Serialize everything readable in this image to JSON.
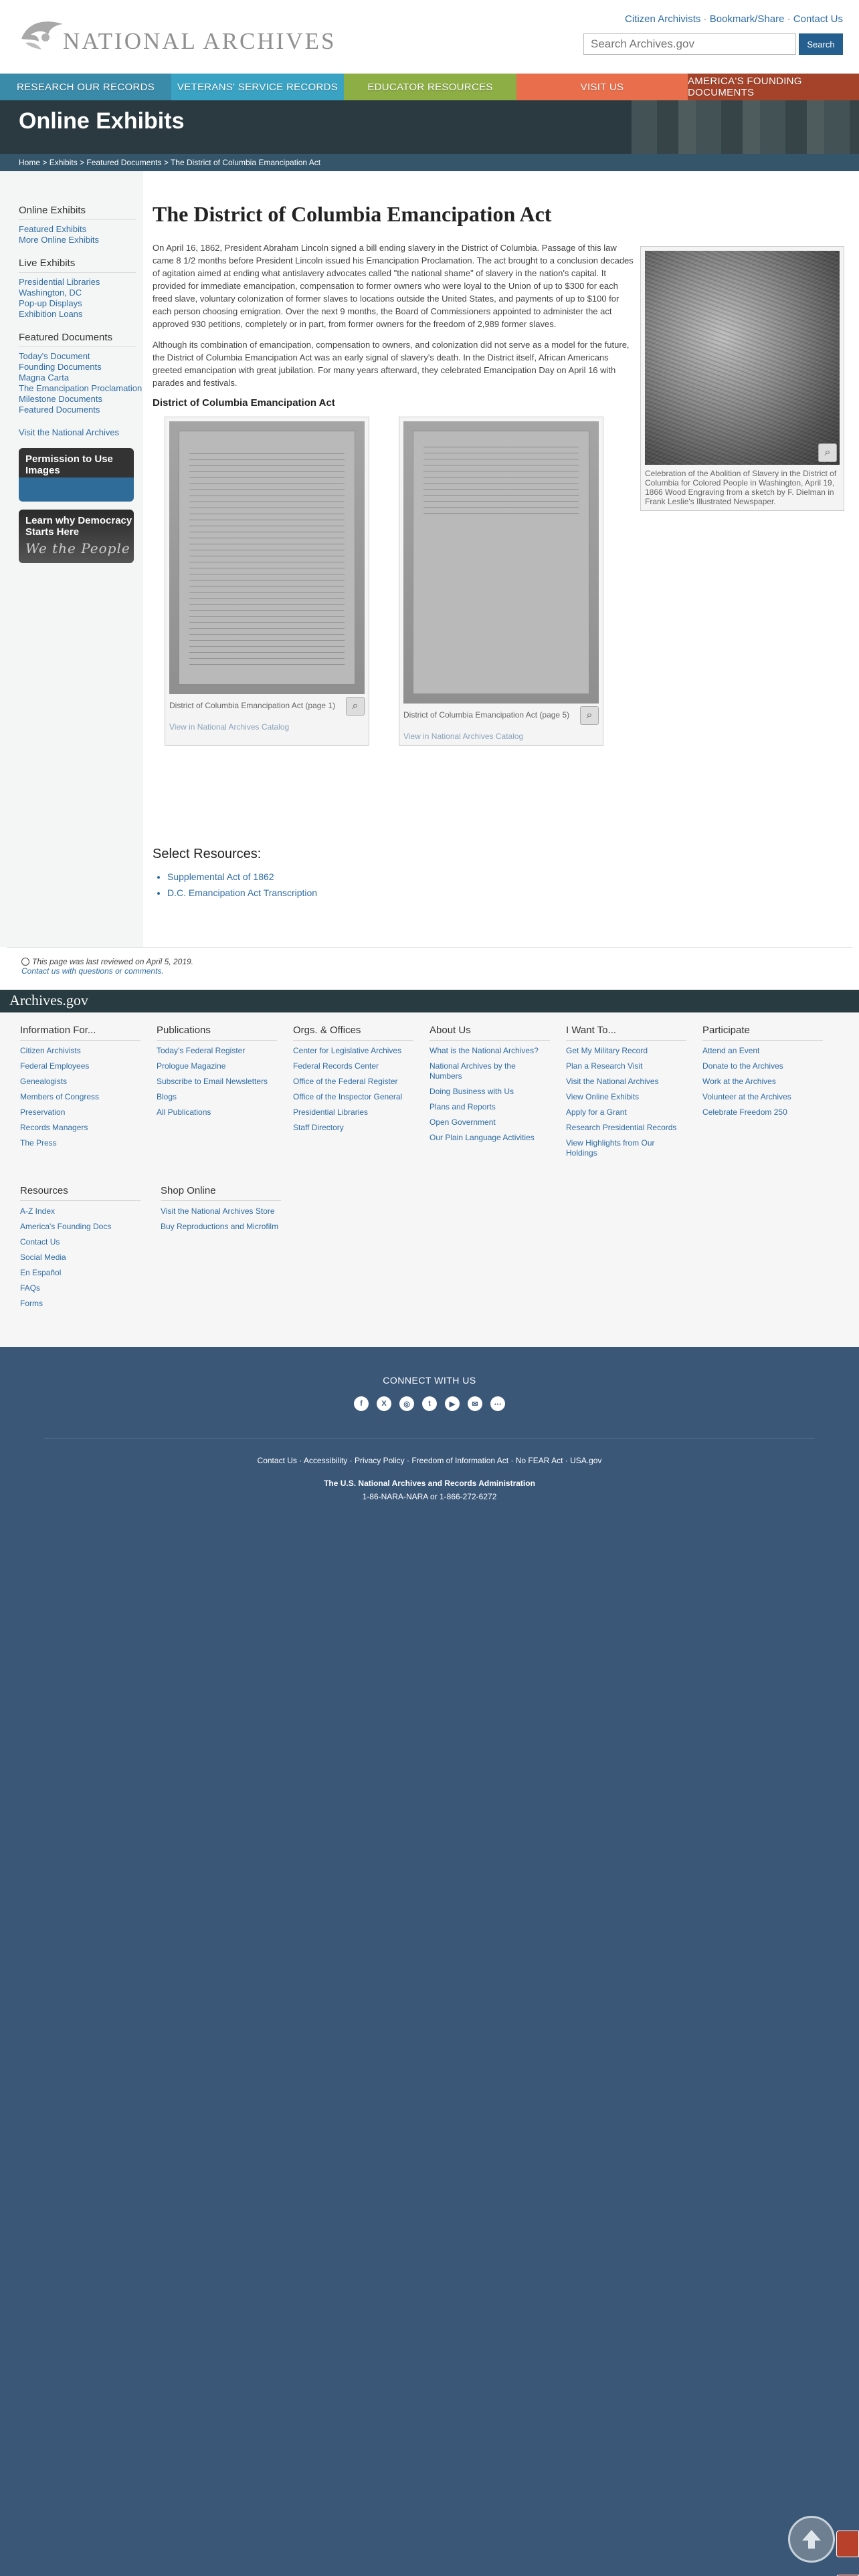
{
  "header": {
    "logo_text": "NATIONAL ARCHIVES",
    "utility_links": [
      "Citizen Archivists",
      "Bookmark/Share",
      "Contact Us"
    ],
    "search_placeholder": "Search Archives.gov",
    "search_button": "Search"
  },
  "nav": [
    {
      "label": "Research Our Records",
      "color": "#3a8aa9"
    },
    {
      "label": "Veterans' Service Records",
      "color": "#3aa3c4"
    },
    {
      "label": "Educator Resources",
      "color": "#8cae44"
    },
    {
      "label": "Visit Us",
      "color": "#e96e4c"
    },
    {
      "label": "America's Founding Documents",
      "color": "#a5432a"
    }
  ],
  "hero": {
    "title": "Online Exhibits"
  },
  "breadcrumb": [
    "Home",
    "Exhibits",
    "Featured Documents",
    "The District of Columbia Emancipation Act"
  ],
  "sidebar": {
    "sections": [
      {
        "heading": "Online Exhibits",
        "items": [
          "Featured Exhibits",
          "More Online Exhibits"
        ]
      },
      {
        "heading": "Live Exhibits",
        "items": [
          "Presidential Libraries",
          "Washington, DC",
          "Pop-up Displays",
          "Exhibition Loans"
        ]
      },
      {
        "heading": "Featured Documents",
        "items": [
          "Today's Document",
          "Founding Documents",
          "Magna Carta",
          "The Emancipation Proclamation",
          "Milestone Documents",
          "Featured Documents"
        ]
      }
    ],
    "visit_link": "Visit the National Archives",
    "promo_permission": "Permission to Use Images",
    "promo_democracy": "Learn why Democracy Starts Here"
  },
  "main": {
    "title": "The District of Columbia Emancipation Act",
    "paragraphs": [
      "On April 16, 1862, President Abraham Lincoln signed a bill ending slavery in the District of Columbia. Passage of this law came 8 1/2 months before President Lincoln issued his Emancipation Proclamation. The act brought to a conclusion decades of agitation aimed at ending what antislavery advocates called \"the national shame\" of slavery in the nation's capital. It provided for immediate emancipation, compensation to former owners who were loyal to the Union of up to $300 for each freed slave, voluntary colonization of former slaves to locations outside the United States, and payments of up to $100 for each person choosing emigration. Over the next 9 months, the Board of Commissioners appointed to administer the act approved 930 petitions, completely or in part, from former owners for the freedom of 2,989 former slaves.",
      "Although its combination of emancipation, compensation to owners, and colonization did not serve as a model for the future, the District of Columbia Emancipation Act was an early signal of slavery's death. In the District itself, African Americans greeted emancipation with great jubilation. For many years afterward, they celebrated Emancipation Day on April 16 with parades and festivals."
    ],
    "figure_caption": "Celebration of the Abolition of Slavery in the District of Columbia for Colored People in Washington, April 19, 1866 Wood Engraving from a sketch by F. Dielman in Frank Leslie's Illustrated Newspaper.",
    "section_heading": "District of Columbia Emancipation Act",
    "documents": [
      {
        "caption": "District of Columbia Emancipation Act (page 1)",
        "link": "View in National Archives Catalog"
      },
      {
        "caption": "District of Columbia Emancipation Act (page 5)",
        "link": "View in National Archives Catalog"
      }
    ],
    "resources_heading": "Select Resources:",
    "resources": [
      "Supplemental Act of 1862",
      "D.C. Emancipation Act Transcription"
    ]
  },
  "reviewed": {
    "text": "This page was last reviewed on April 5, 2019.",
    "contact": "Contact us with questions or comments."
  },
  "footer": {
    "brand": "Archives.gov",
    "columns": [
      {
        "heading": "Information For...",
        "items": [
          "Citizen Archivists",
          "Federal Employees",
          "Genealogists",
          "Members of Congress",
          "Preservation",
          "Records Managers",
          "The Press"
        ]
      },
      {
        "heading": "Publications",
        "items": [
          "Today's Federal Register",
          "Prologue Magazine",
          "Subscribe to Email Newsletters",
          "Blogs",
          "All Publications"
        ]
      },
      {
        "heading": "Orgs. & Offices",
        "items": [
          "Center for Legislative Archives",
          "Federal Records Center",
          "Office of the Federal Register",
          "Office of the Inspector General",
          "Presidential Libraries",
          "Staff Directory"
        ]
      },
      {
        "heading": "About Us",
        "items": [
          "What is the National Archives?",
          "National Archives by the Numbers",
          "Doing Business with Us",
          "Plans and Reports",
          "Open Government",
          "Our Plain Language Activities"
        ]
      },
      {
        "heading": "I Want To...",
        "items": [
          "Get My Military Record",
          "Plan a Research Visit",
          "Visit the National Archives",
          "View Online Exhibits",
          "Apply for a Grant",
          "Research Presidential Records",
          "View Highlights from Our Holdings"
        ]
      },
      {
        "heading": "Participate",
        "items": [
          "Attend an Event",
          "Donate to the Archives",
          "Work at the Archives",
          "Volunteer at the Archives",
          "Celebrate Freedom 250"
        ]
      }
    ],
    "columns2": [
      {
        "heading": "Resources",
        "items": [
          "A-Z Index",
          "America's Founding Docs",
          "Contact Us",
          "Social Media",
          "En Español",
          "FAQs",
          "Forms"
        ]
      },
      {
        "heading": "Shop Online",
        "items": [
          "Visit the National Archives Store",
          "Buy Reproductions and Microfilm"
        ]
      }
    ],
    "connect_heading": "CONNECT WITH US",
    "socials": [
      "facebook-icon",
      "x-icon",
      "instagram-icon",
      "tumblr-icon",
      "youtube-icon",
      "email-icon",
      "more-icon"
    ],
    "social_glyphs": [
      "f",
      "X",
      "◎",
      "t",
      "▶",
      "✉",
      "⋯"
    ],
    "bottom_links": [
      "Contact Us",
      "Accessibility",
      "Privacy Policy",
      "Freedom of Information Act",
      "No FEAR Act",
      "USA.gov"
    ],
    "agency": "The U.S. National Archives and Records Administration",
    "phone": "1-86-NARA-NARA or 1-866-272-6272"
  }
}
